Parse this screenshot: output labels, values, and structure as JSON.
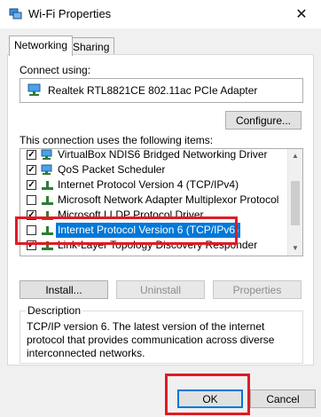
{
  "window": {
    "title": "Wi-Fi Properties",
    "close_glyph": "✕"
  },
  "tabs": [
    {
      "label": "Networking",
      "active": true
    },
    {
      "label": "Sharing",
      "active": false
    }
  ],
  "connect_using": {
    "label": "Connect using:",
    "adapter": "Realtek RTL8821CE 802.11ac PCIe Adapter",
    "configure_label": "Configure..."
  },
  "items_section": {
    "label": "This connection uses the following items:",
    "items": [
      {
        "label": "VirtualBox NDIS6 Bridged Networking Driver",
        "checked": true,
        "icon": "network-adapter-icon"
      },
      {
        "label": "QoS Packet Scheduler",
        "checked": true,
        "icon": "network-adapter-icon"
      },
      {
        "label": "Internet Protocol Version 4 (TCP/IPv4)",
        "checked": true,
        "icon": "protocol-icon"
      },
      {
        "label": "Microsoft Network Adapter Multiplexor Protocol",
        "checked": false,
        "icon": "protocol-icon"
      },
      {
        "label": "Microsoft LLDP Protocol Driver",
        "checked": true,
        "icon": "protocol-icon"
      },
      {
        "label": "Internet Protocol Version 6 (TCP/IPv6)",
        "checked": false,
        "icon": "protocol-icon",
        "selected": true
      },
      {
        "label": "Link-Layer Topology Discovery Responder",
        "checked": true,
        "icon": "protocol-icon"
      }
    ]
  },
  "item_buttons": {
    "install": "Install...",
    "uninstall": "Uninstall",
    "properties": "Properties"
  },
  "description": {
    "legend": "Description",
    "text": "TCP/IP version 6. The latest version of the internet protocol that provides communication across diverse interconnected networks."
  },
  "footer": {
    "ok": "OK",
    "cancel": "Cancel"
  },
  "colors": {
    "selection": "#0078d7",
    "highlight": "#e01b24",
    "focus": "#0078d7"
  }
}
